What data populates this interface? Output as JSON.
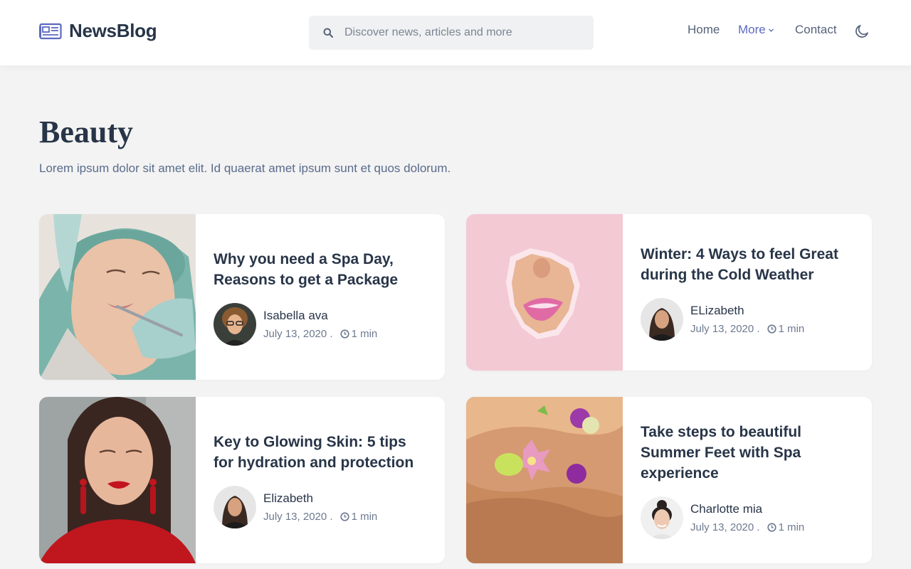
{
  "brand": {
    "name": "NewsBlog",
    "icon": "newspaper-icon",
    "color": "#5b6ac0"
  },
  "search": {
    "placeholder": "Discover news, articles and more",
    "value": "",
    "icon": "search-icon"
  },
  "nav": {
    "home": "Home",
    "more": "More",
    "contact": "Contact",
    "active_color": "#5b6ac0",
    "theme_icon": "moon-icon"
  },
  "page": {
    "title": "Beauty",
    "description": "Lorem ipsum dolor sit amet elit. Id quaerat amet ipsum sunt et quos dolorum."
  },
  "articles": [
    {
      "title": "Why you need a Spa Day, Reasons to get a Package",
      "author": "Isabella ava",
      "date": "July 13, 2020 .",
      "read_time": "1 min",
      "image": "spa-facial-treatment-photo"
    },
    {
      "title": "Winter: 4 Ways to feel Great during the Cold Weather",
      "author": "ELizabeth",
      "date": "July 13, 2020 .",
      "read_time": "1 min",
      "image": "lips-through-pink-paper-photo"
    },
    {
      "title": "Key to Glowing Skin: 5 tips for hydration and protection",
      "author": "Elizabeth",
      "date": "July 13, 2020 .",
      "read_time": "1 min",
      "image": "woman-red-lipstick-portrait-photo"
    },
    {
      "title": "Take steps to beautiful Summer Feet with Spa experience",
      "author": "Charlotte mia",
      "date": "July 13, 2020 .",
      "read_time": "1 min",
      "image": "feet-spa-flowers-photo"
    }
  ]
}
